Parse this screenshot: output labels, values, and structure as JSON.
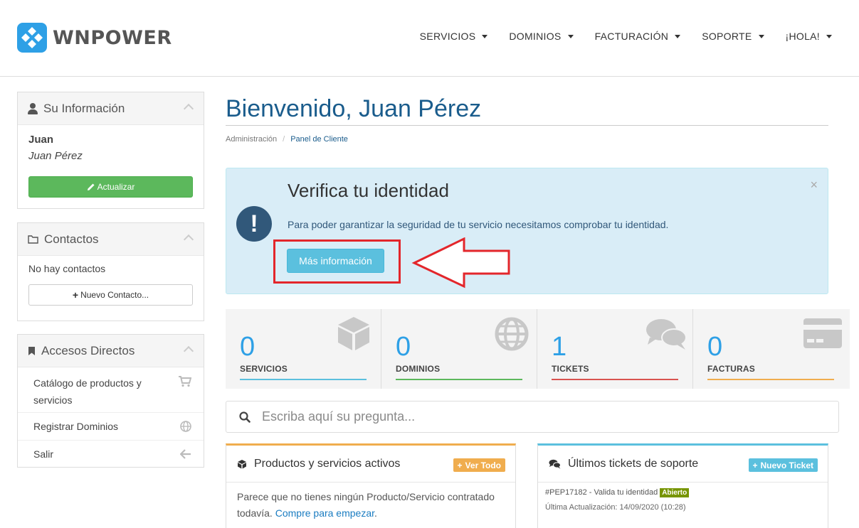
{
  "brand": {
    "name": "WNPOWER"
  },
  "nav": [
    {
      "label": "SERVICIOS"
    },
    {
      "label": "DOMINIOS"
    },
    {
      "label": "FACTURACIÓN"
    },
    {
      "label": "SOPORTE"
    },
    {
      "label": "¡HOLA!"
    }
  ],
  "sidebar": {
    "info": {
      "title": "Su Información",
      "first_name": "Juan",
      "full_name": "Juan Pérez",
      "update_button": "Actualizar"
    },
    "contacts": {
      "title": "Contactos",
      "empty": "No hay contactos",
      "new_button": "Nuevo Contacto..."
    },
    "shortcuts": {
      "title": "Accesos Directos",
      "items": [
        {
          "label": "Catálogo de productos y servicios",
          "icon": "cart-icon"
        },
        {
          "label": "Registrar Dominios",
          "icon": "globe-icon"
        },
        {
          "label": "Salir",
          "icon": "arrow-left-icon"
        }
      ]
    }
  },
  "main": {
    "title": "Bienvenido, Juan Pérez",
    "breadcrumb": [
      "Administración",
      "Panel de Cliente"
    ],
    "alert": {
      "title": "Verifica tu identidad",
      "text": "Para poder garantizar la seguridad de tu servicio necesitamos comprobar tu identidad.",
      "button": "Más información",
      "close": "×"
    },
    "stats": [
      {
        "value": "0",
        "label": "SERVICIOS",
        "color": "#5bc0de",
        "icon": "cube-icon"
      },
      {
        "value": "0",
        "label": "DOMINIOS",
        "color": "#5cb85c",
        "icon": "globe-icon"
      },
      {
        "value": "1",
        "label": "TICKETS",
        "color": "#d9534f",
        "icon": "comments-icon"
      },
      {
        "value": "0",
        "label": "FACTURAS",
        "color": "#f0ad4e",
        "icon": "credit-card-icon"
      }
    ],
    "search": {
      "placeholder": "Escriba aquí su pregunta..."
    },
    "products": {
      "title": "Productos y servicios activos",
      "button": "Ver Todo",
      "text": "Parece que no tienes ningún Producto/Servicio contratado todavía.",
      "link": "Compre para empezar",
      "after_link": "."
    },
    "tickets": {
      "title": "Últimos tickets de soporte",
      "button": "Nuevo Ticket",
      "ticket_line": "#PEP17182 - Valida tu identidad",
      "status": "Abierto",
      "updated": "Última Actualización: 14/09/2020 (10:28)"
    }
  }
}
